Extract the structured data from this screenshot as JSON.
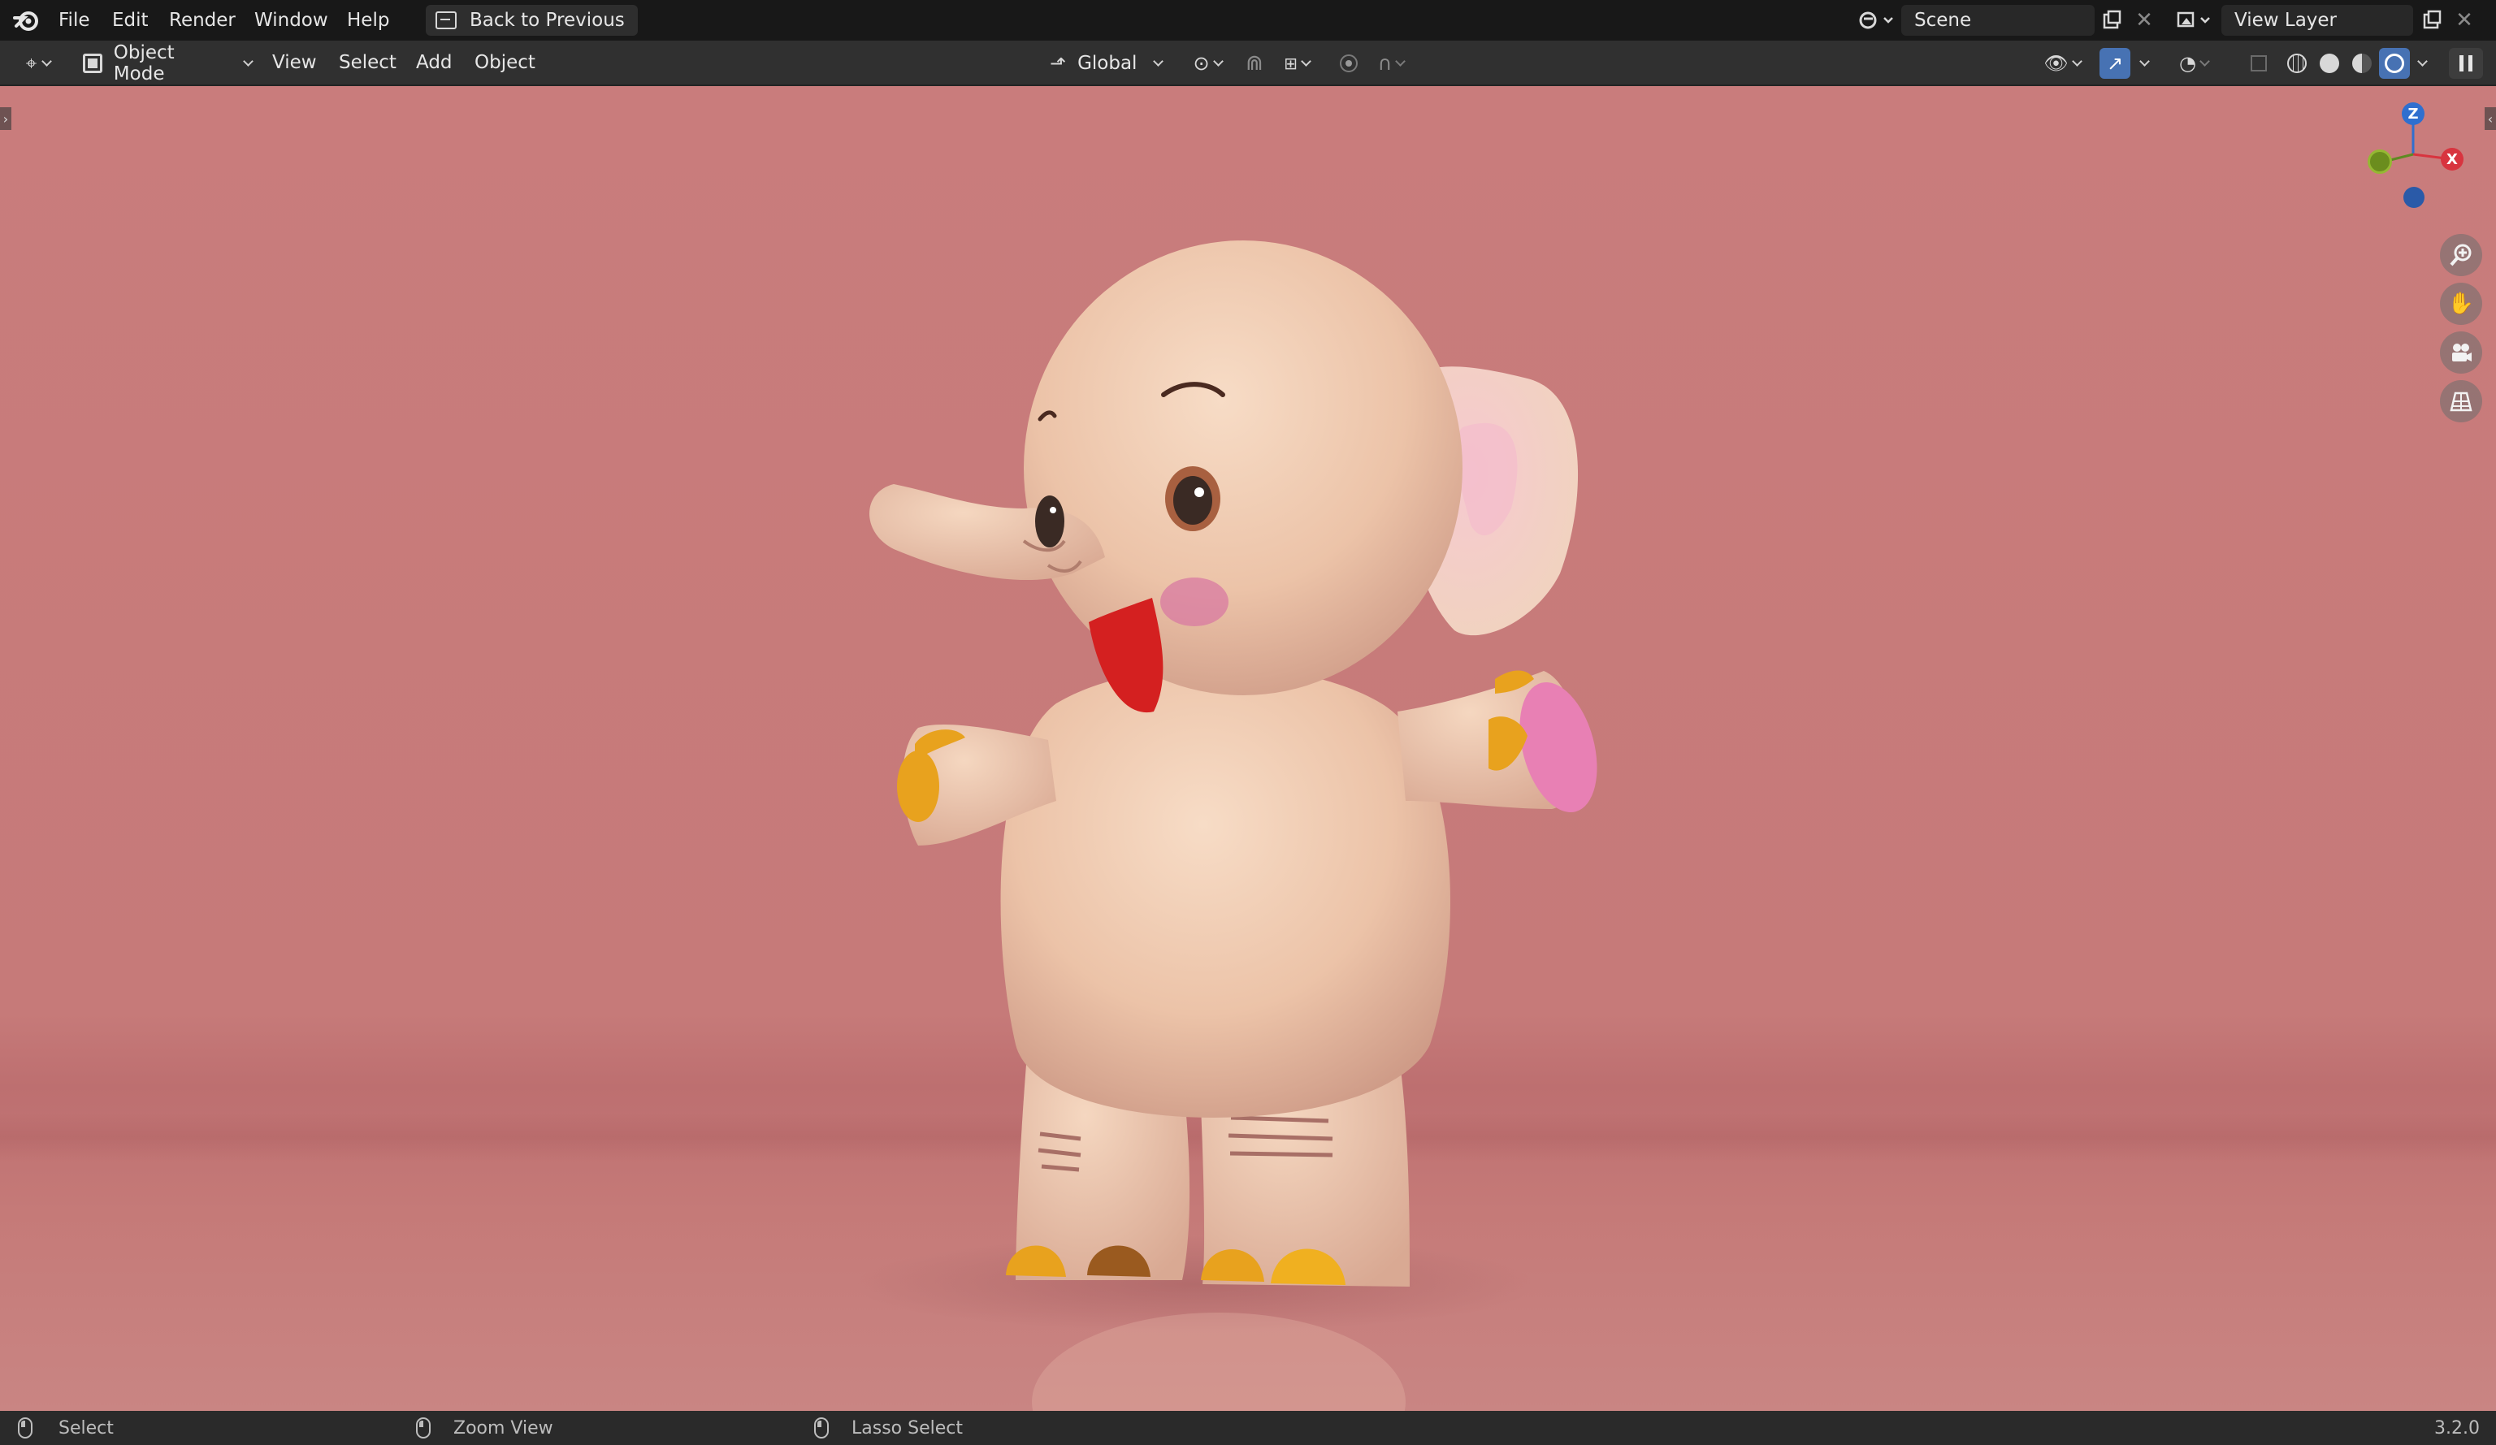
{
  "topbar": {
    "menu": [
      "File",
      "Edit",
      "Render",
      "Window",
      "Help"
    ],
    "back_button": "Back to Previous",
    "scene_name": "Scene",
    "view_layer_name": "View Layer"
  },
  "header": {
    "mode": "Object Mode",
    "menus": [
      "View",
      "Select",
      "Add",
      "Object"
    ],
    "transform_orientation": "Global"
  },
  "viewport": {
    "gizmo_axes": [
      "Z",
      "X"
    ],
    "nav_icons": [
      "zoom-icon",
      "pan-hand-icon",
      "camera-icon",
      "grid-ortho-icon"
    ],
    "colors": {
      "background": "#c97c7c",
      "elephant_body": "#f1cfb8",
      "mouth": "#d42020",
      "toes": "#e8a21e",
      "foot_pad": "#e880b4"
    }
  },
  "statusbar": {
    "left_action": "Select",
    "middle_action": "Zoom View",
    "right_action": "Lasso Select",
    "version": "3.2.0"
  }
}
